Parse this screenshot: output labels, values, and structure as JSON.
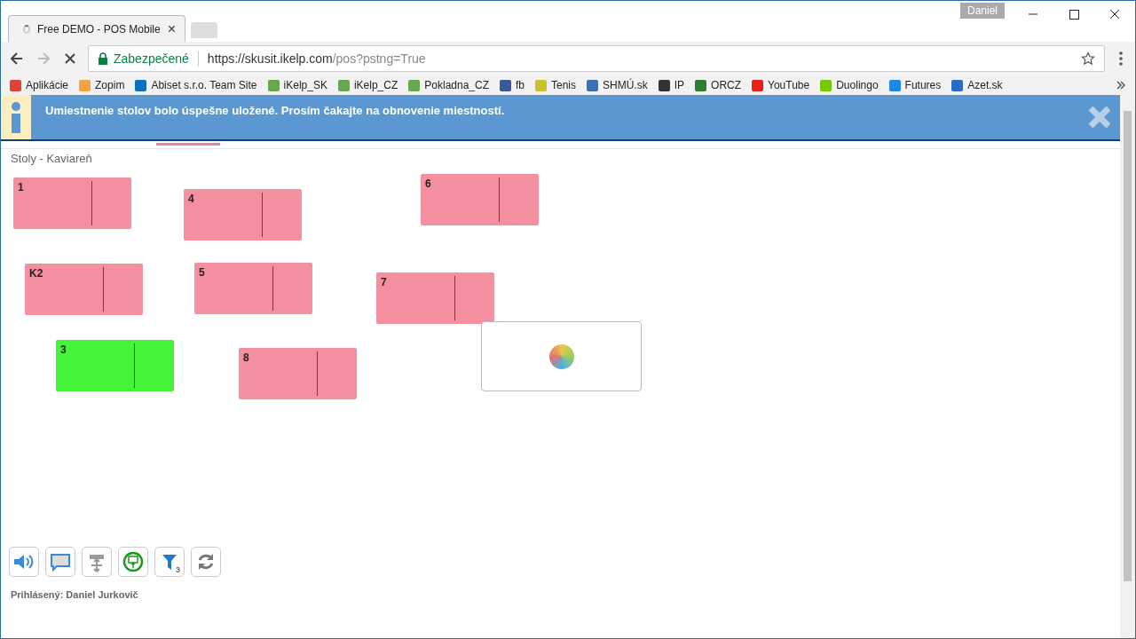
{
  "window": {
    "user_badge": "Daniel"
  },
  "tabs": [
    {
      "title": "Free DEMO - POS Mobile",
      "close": "×",
      "selected": true
    },
    {
      "selected": false
    }
  ],
  "address_bar": {
    "security": "Zabezpečené",
    "url_host": "https://skusit.ikelp.com",
    "url_path": "/pos?pstng=True"
  },
  "bookmarks": [
    {
      "label": "Aplikácie",
      "color": "#db4437"
    },
    {
      "label": "Zopim",
      "color": "#f4a23b"
    },
    {
      "label": "Abiset s.r.o. Team Site",
      "color": "#0a6fbf"
    },
    {
      "label": "iKelp_SK",
      "color": "#6aa84f"
    },
    {
      "label": "iKelp_CZ",
      "color": "#6aa84f"
    },
    {
      "label": "Pokladna_CZ",
      "color": "#6aa84f"
    },
    {
      "label": "fb",
      "color": "#3b5998"
    },
    {
      "label": "Tenis",
      "color": "#c9c22a"
    },
    {
      "label": "SHMÚ.sk",
      "color": "#3d6fb6"
    },
    {
      "label": "IP",
      "color": "#333333"
    },
    {
      "label": "ORCZ",
      "color": "#2e7d32"
    },
    {
      "label": "YouTube",
      "color": "#e62117"
    },
    {
      "label": "Duolingo",
      "color": "#78c800"
    },
    {
      "label": "Futures",
      "color": "#1e88e5"
    },
    {
      "label": "Azet.sk",
      "color": "#2b6cc4"
    }
  ],
  "notification": {
    "message": "Umiestnenie stolov bolo úspešne uložené. Prosím čakajte na obnovenie miestností."
  },
  "room": {
    "title": "Stoly - Kaviareň"
  },
  "tables": [
    {
      "label": "1",
      "occupied": false
    },
    {
      "label": "4",
      "occupied": false
    },
    {
      "label": "6",
      "occupied": false
    },
    {
      "label": "K2",
      "occupied": false
    },
    {
      "label": "5",
      "occupied": false
    },
    {
      "label": "7",
      "occupied": false
    },
    {
      "label": "3",
      "occupied": true
    },
    {
      "label": "8",
      "occupied": false
    }
  ],
  "loading": {
    "visible": true
  },
  "toolbar": [
    {
      "kind": "sound"
    },
    {
      "kind": "message"
    },
    {
      "kind": "move"
    },
    {
      "kind": "export"
    },
    {
      "kind": "filter",
      "badge": "3"
    },
    {
      "kind": "refresh"
    }
  ],
  "footer": {
    "logged_in": "Prihlásený: Daniel Jurkovič"
  }
}
